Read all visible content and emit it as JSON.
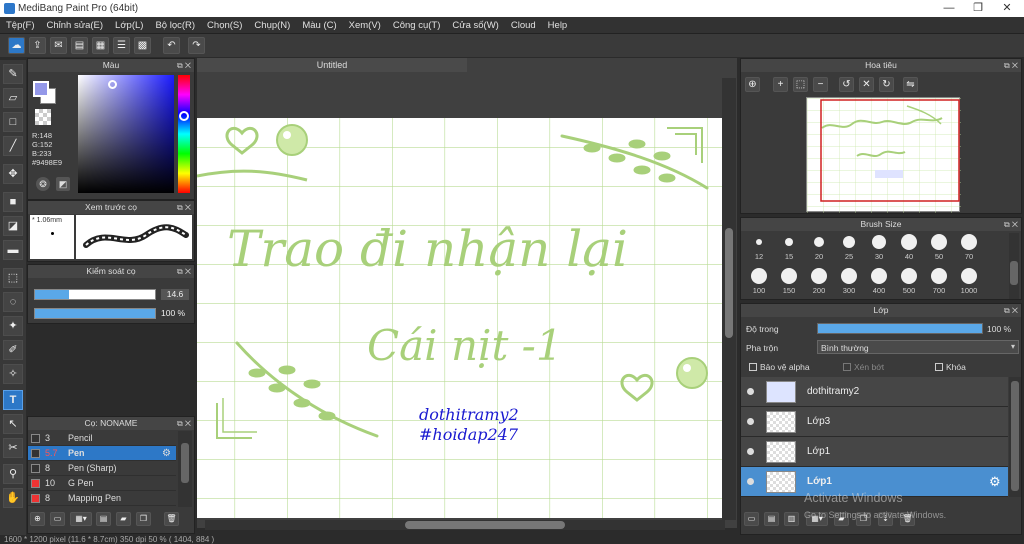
{
  "window": {
    "title": "MediBang Paint Pro (64bit)",
    "minimize": "—",
    "restore": "❐",
    "close": "✕"
  },
  "menu": [
    "Tệp(F)",
    "Chỉnh sửa(E)",
    "Lớp(L)",
    "Bộ lọc(R)",
    "Chọn(S)",
    "Chụp(N)",
    "Màu (C)",
    "Xem(V)",
    "Công cụ(T)",
    "Cửa số(W)",
    "Cloud",
    "Help"
  ],
  "panels": {
    "color": {
      "title": "Màu",
      "r": "R:148",
      "g": "G:152",
      "b": "B:233",
      "hex": "#9498E9"
    },
    "brush_preview": {
      "title": "Xem trước cọ",
      "size": "* 1.06mm"
    },
    "brush_control": {
      "title": "Kiểm soát cọ",
      "size_value": "14.6",
      "opacity_value": "100 %"
    },
    "brush_list": {
      "title": "Cọ: NONAME",
      "items": [
        {
          "size": "3",
          "name": "Pencil"
        },
        {
          "size": "5.7",
          "name": "Pen"
        },
        {
          "size": "8",
          "name": "Pen (Sharp)"
        },
        {
          "size": "10",
          "name": "G Pen"
        },
        {
          "size": "8",
          "name": "Mapping Pen"
        }
      ]
    },
    "navigator": {
      "title": "Hoa tiêu"
    },
    "brush_size": {
      "title": "Brush Size",
      "sizes": [
        "12",
        "15",
        "20",
        "25",
        "30",
        "40",
        "50",
        "70",
        "100",
        "150",
        "200",
        "300",
        "400",
        "500",
        "700",
        "1000"
      ]
    },
    "layers": {
      "title": "Lớp",
      "opacity_label": "Độ trong",
      "opacity_value": "100 %",
      "opacity_level": 1.0,
      "blend_label": "Pha trộn",
      "blend_value": "Bình thường",
      "protect_alpha": "Bảo vệ alpha",
      "clipping": "Xén bớt",
      "lock": "Khóa",
      "items": [
        {
          "name": "dothitramy2"
        },
        {
          "name": "Lớp3"
        },
        {
          "name": "Lớp1"
        },
        {
          "name": "Lớp1"
        }
      ]
    }
  },
  "document": {
    "tab": "Untitled",
    "art": {
      "line1": "Trao đi nhận lại",
      "line2": "Cái nịt -1",
      "credit1": "dothitramy2",
      "credit2": "#hoidap247"
    }
  },
  "watermark": {
    "line1": "Activate Windows",
    "line2": "Go to Settings to activate Windows."
  },
  "status": "1600 * 1200 pixel   (11.6 * 8.7cm)   350 dpi   50 %   ( 1404, 884 )",
  "colors": {
    "accent": "#2d78c7",
    "art": "#a8d07a",
    "credit": "#1a1ad0",
    "current_color": "#9498E9"
  }
}
